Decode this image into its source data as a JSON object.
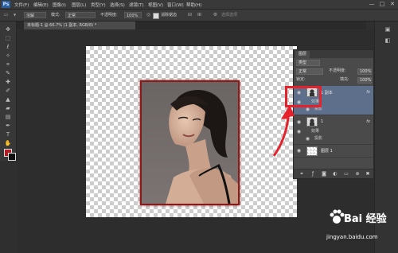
{
  "app": {
    "logo": "Ps"
  },
  "menu": [
    "文件(F)",
    "编辑(E)",
    "图像(I)",
    "图层(L)",
    "类型(Y)",
    "选择(S)",
    "滤镜(T)",
    "视图(V)",
    "窗口(W)",
    "帮助(H)"
  ],
  "window_controls": [
    "—",
    "□",
    "✕"
  ],
  "options": {
    "brush_value": "溶解",
    "mode_label": "模式:",
    "mode_value": "正常",
    "opacity_label": "不透明度:",
    "opacity_value": "100%",
    "antialias_label": "消除锯齿",
    "search_placeholder": "选择选项"
  },
  "document": {
    "tab_label": "未标题-1 @ 66.7% (1 副本, RGB/8) *"
  },
  "layers_panel": {
    "tab": "图层",
    "kind_label": "类型",
    "blend_mode": "正常",
    "opacity_label": "不透明度:",
    "opacity_value": "100%",
    "lock_label": "锁定:",
    "fill_label": "填充:",
    "fill_value": "100%",
    "layers": [
      {
        "name": "1 副本",
        "fx": "fx",
        "effects_label": "效果",
        "effect": "投影",
        "selected": true
      },
      {
        "name": "1",
        "fx": "fx",
        "effects_label": "效果",
        "effect": "投影",
        "selected": false
      },
      {
        "name": "图层 1",
        "selected": false
      }
    ]
  },
  "colors": {
    "foreground": "#b01e25",
    "background": "#111111",
    "highlight": "#e5222b"
  },
  "watermark": {
    "brand": "Bai 经验",
    "url": "jingyan.baidu.com"
  }
}
